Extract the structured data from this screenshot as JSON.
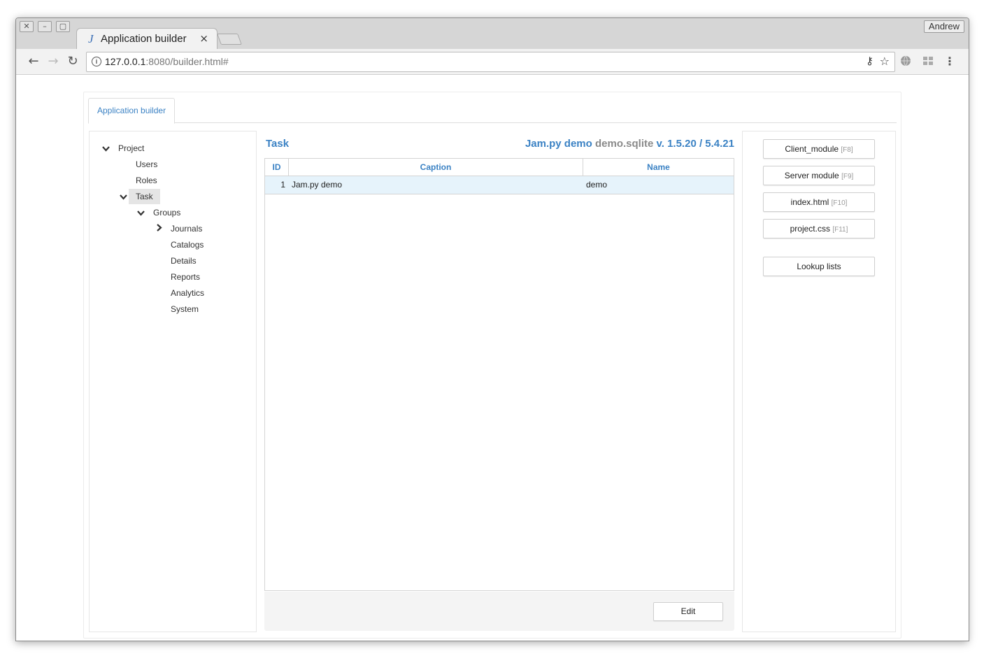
{
  "window": {
    "controls": [
      "✕",
      "–",
      "▢"
    ],
    "user": "Andrew"
  },
  "browser_tab": {
    "icon": "J",
    "title": "Application builder",
    "close": "×"
  },
  "toolbar": {
    "back": "←",
    "forward": "→",
    "reload": "↻",
    "url_host": "127.0.0.1",
    "url_rest": ":8080/builder.html#",
    "key": "⚷",
    "star": "☆",
    "menu": "⋮"
  },
  "page": {
    "tab_label": "Application builder",
    "tree": {
      "project": "Project",
      "users": "Users",
      "roles": "Roles",
      "task": "Task",
      "groups": "Groups",
      "journals": "Journals",
      "catalogs": "Catalogs",
      "details": "Details",
      "reports": "Reports",
      "analytics": "Analytics",
      "system": "System"
    },
    "chevrons": {
      "down": "⌄",
      "right": "›"
    },
    "center": {
      "title": "Task",
      "app_name": "Jam.py demo",
      "db_name": "demo.sqlite",
      "version": "v. 1.5.20 / 5.4.21"
    },
    "grid": {
      "columns": [
        "ID",
        "Caption",
        "Name"
      ],
      "rows": [
        [
          "1",
          "Jam.py demo",
          "demo"
        ]
      ]
    },
    "edit_button": "Edit",
    "right_buttons": [
      {
        "label": "Client_module",
        "hint": "[F8]"
      },
      {
        "label": "Server module",
        "hint": "[F9]"
      },
      {
        "label": "index.html",
        "hint": "[F10]"
      },
      {
        "label": "project.css",
        "hint": "[F11]"
      }
    ],
    "lookup_button": "Lookup lists"
  },
  "colors": {
    "accent": "#3b82c4",
    "selected_row": "#e6f3fb",
    "tree_selected": "#e5e5e5",
    "muted": "#8a8a8a"
  },
  "icons": [
    "close-window-icon",
    "minimize-icon",
    "maximize-icon",
    "jam-favicon-icon",
    "back-arrow-icon",
    "forward-arrow-icon",
    "reload-icon",
    "info-icon",
    "key-icon",
    "star-icon",
    "globe-icon",
    "extension-icon",
    "menu-icon",
    "chevron-down-icon",
    "chevron-right-icon"
  ]
}
